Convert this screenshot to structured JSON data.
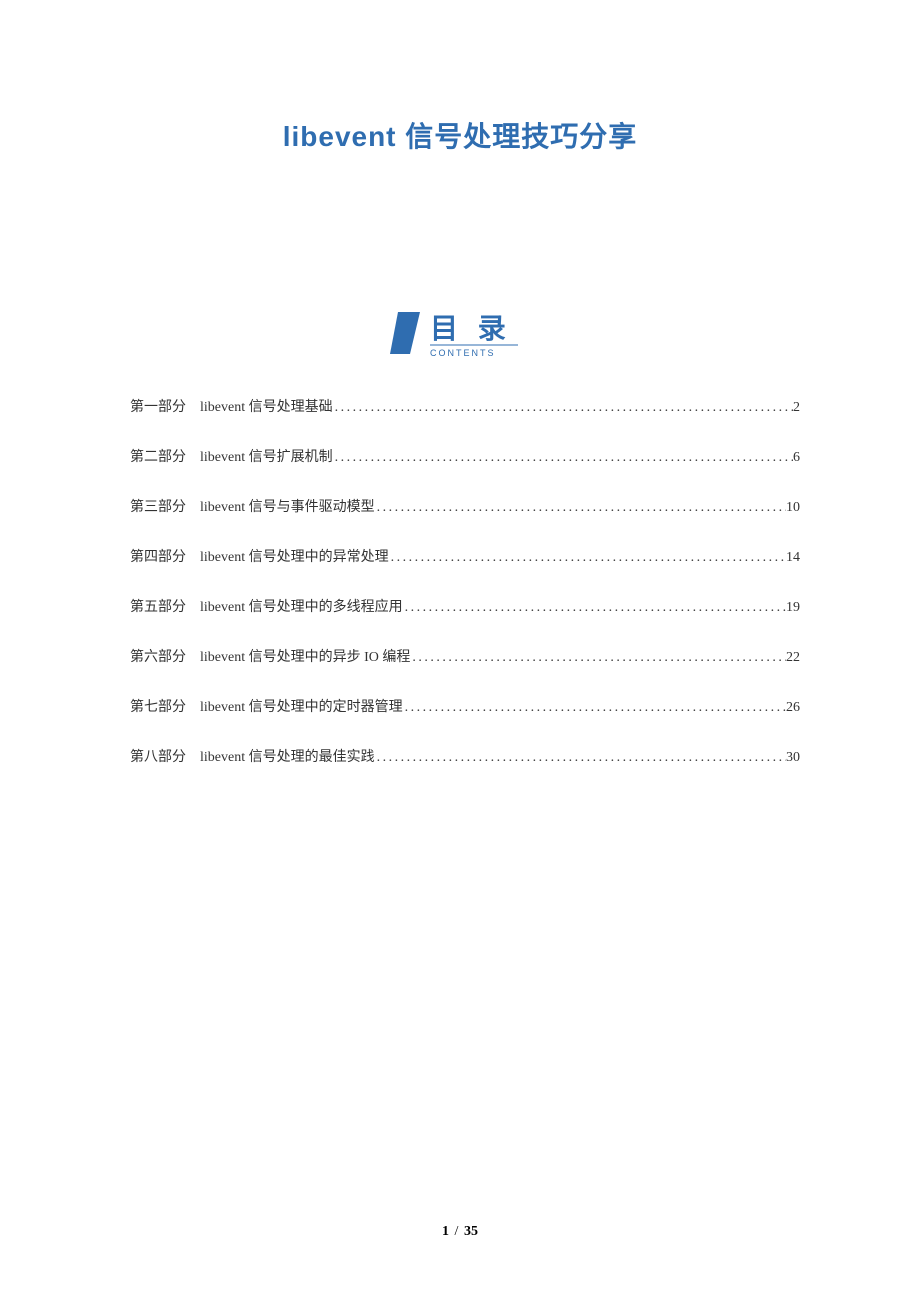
{
  "title": "libevent 信号处理技巧分享",
  "toc_heading": "目 录",
  "toc_sub": "CONTENTS",
  "toc": [
    {
      "part": "第一部分",
      "title": "libevent 信号处理基础",
      "page": "2"
    },
    {
      "part": "第二部分",
      "title": "libevent 信号扩展机制",
      "page": "6"
    },
    {
      "part": "第三部分",
      "title": "libevent 信号与事件驱动模型",
      "page": "10"
    },
    {
      "part": "第四部分",
      "title": "libevent 信号处理中的异常处理",
      "page": "14"
    },
    {
      "part": "第五部分",
      "title": "libevent 信号处理中的多线程应用",
      "page": "19"
    },
    {
      "part": "第六部分",
      "title": "libevent 信号处理中的异步 IO 编程",
      "page": "22"
    },
    {
      "part": "第七部分",
      "title": "libevent 信号处理中的定时器管理",
      "page": "26"
    },
    {
      "part": "第八部分",
      "title": "libevent 信号处理的最佳实践",
      "page": "30"
    }
  ],
  "footer": {
    "current": "1",
    "separator": "/",
    "total": "35"
  }
}
